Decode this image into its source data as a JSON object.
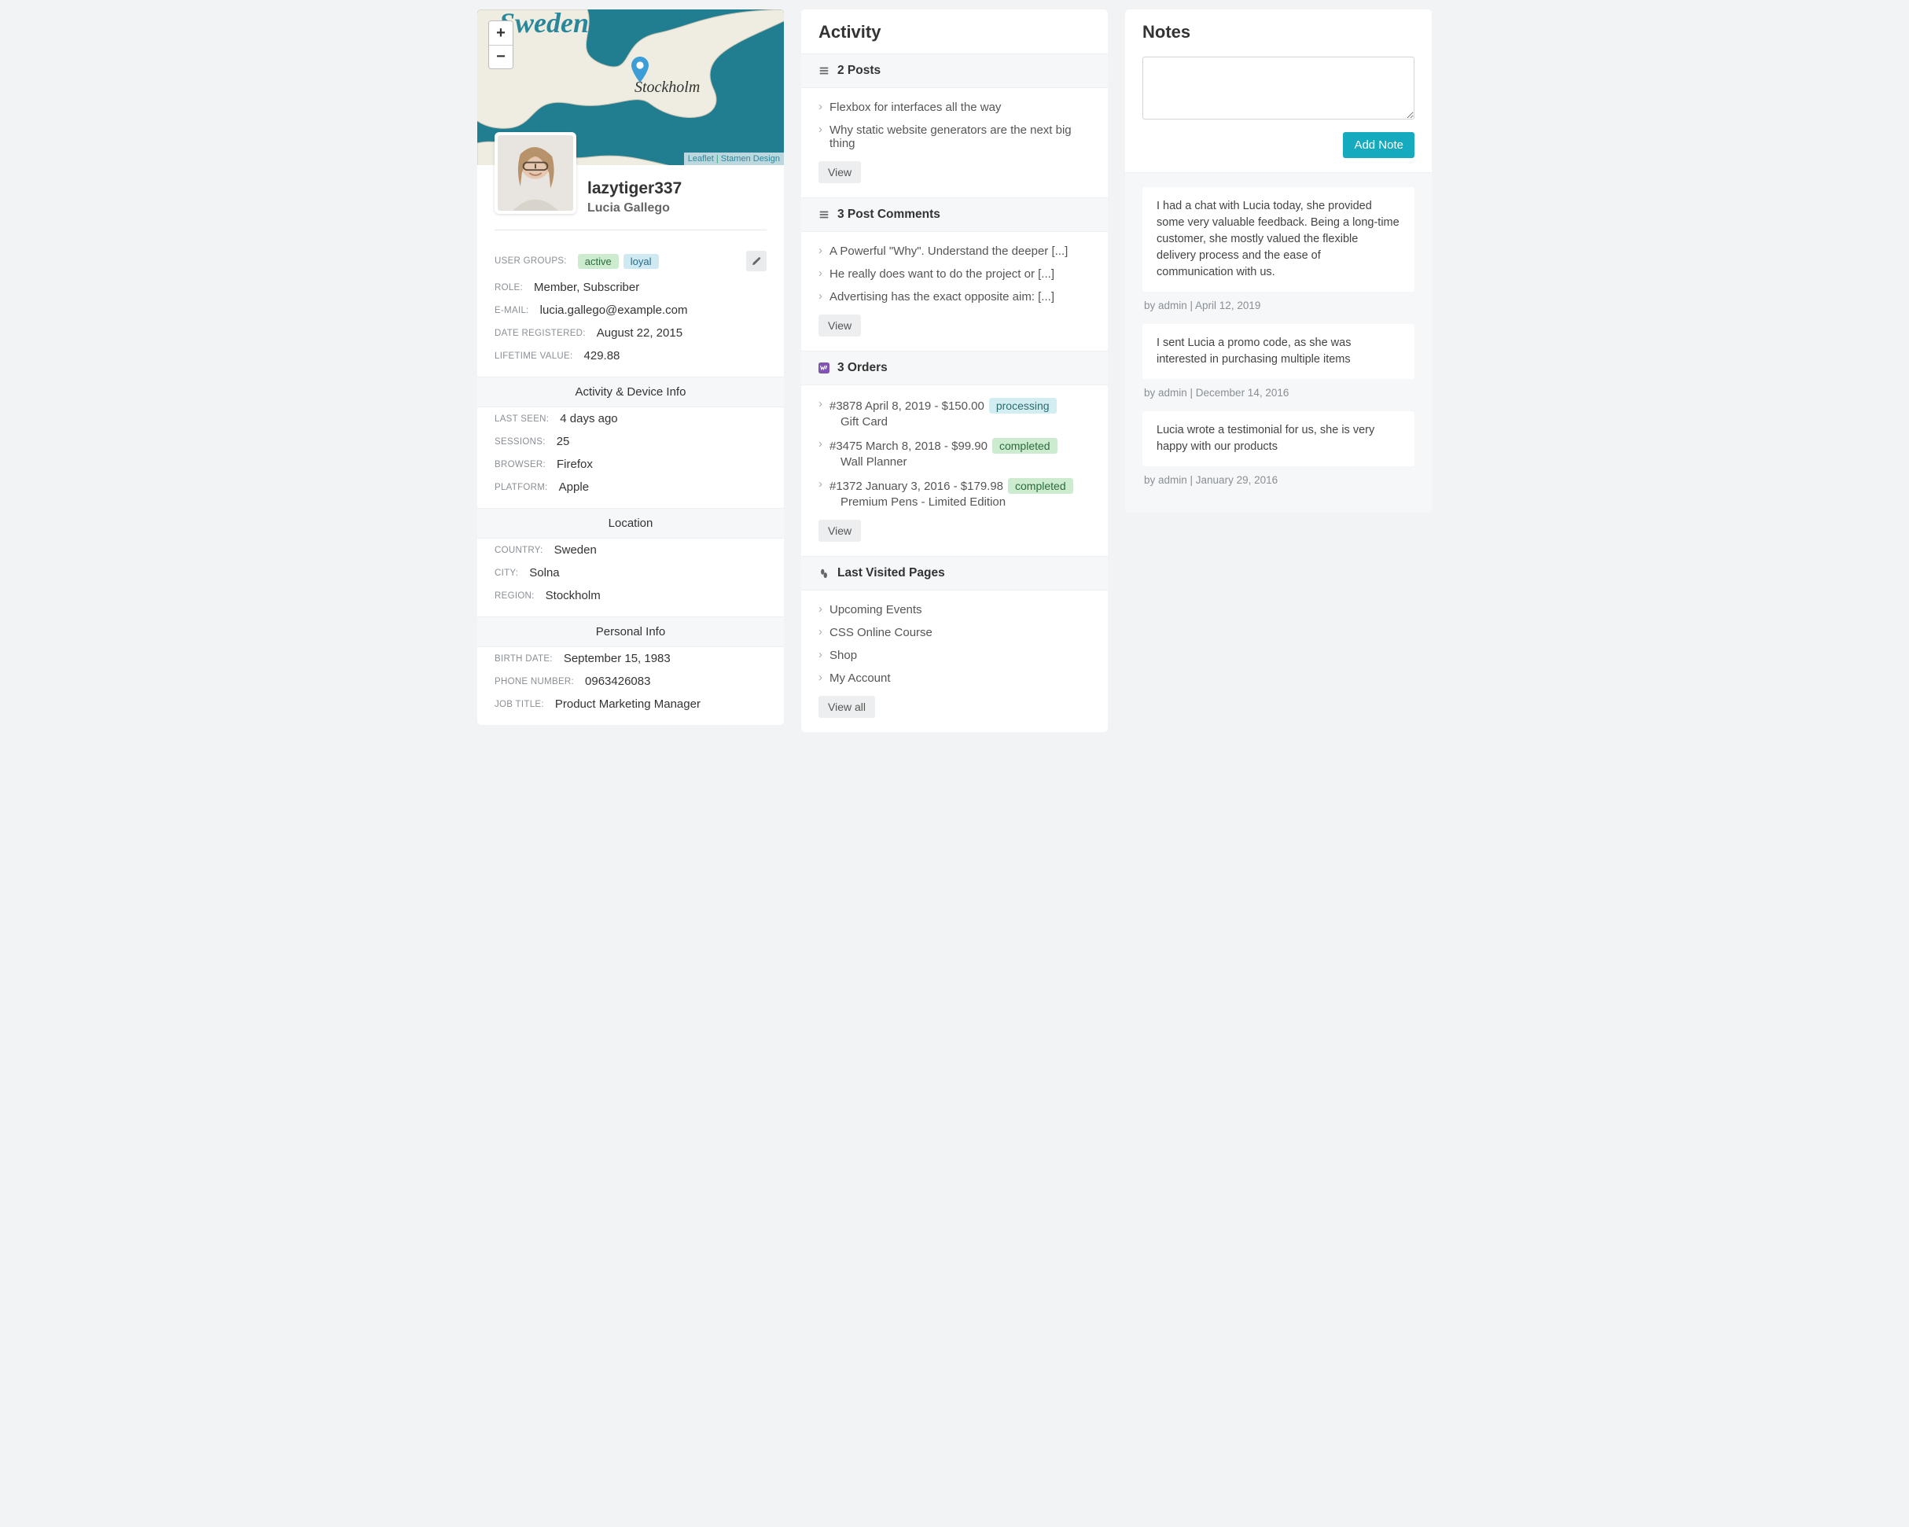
{
  "profile": {
    "map": {
      "country_label": "Sweden",
      "city_label": "Stockholm",
      "attribution_leaflet": "Leaflet",
      "attribution_tiles": "Stamen Design",
      "zoom_in": "+",
      "zoom_out": "−"
    },
    "username": "lazytiger337",
    "fullname": "Lucia Gallego",
    "groups_label": "User Groups:",
    "groups": {
      "active": "active",
      "loyal": "loyal"
    },
    "role_label": "Role:",
    "role_value": "Member, Subscriber",
    "email_label": "E-mail:",
    "email_value": "lucia.gallego@example.com",
    "registered_label": "Date Registered:",
    "registered_value": "August 22, 2015",
    "ltv_label": "Lifetime Value:",
    "ltv_value": "429.88",
    "device_header": "Activity & Device Info",
    "lastseen_label": "Last Seen:",
    "lastseen_value": "4 days ago",
    "sessions_label": "Sessions:",
    "sessions_value": "25",
    "browser_label": "Browser:",
    "browser_value": "Firefox",
    "platform_label": "Platform:",
    "platform_value": "Apple",
    "location_header": "Location",
    "country_label": "Country:",
    "country_value": "Sweden",
    "city_label": "City:",
    "city_value": "Solna",
    "region_label": "Region:",
    "region_value": "Stockholm",
    "personal_header": "Personal Info",
    "birth_label": "Birth Date:",
    "birth_value": "September 15, 1983",
    "phone_label": "Phone Number:",
    "phone_value": "0963426083",
    "job_label": "Job Title:",
    "job_value": "Product Marketing Manager"
  },
  "activity": {
    "heading": "Activity",
    "posts_header": "2 Posts",
    "posts": [
      "Flexbox for interfaces all the way",
      "Why static website generators are the next big thing"
    ],
    "comments_header": "3 Post Comments",
    "comments": [
      "A Powerful \"Why\". Understand the deeper [...]",
      "He really does want to do the project or [...]",
      "Advertising has the exact opposite aim: [...]"
    ],
    "orders_header": "3 Orders",
    "orders": [
      {
        "line": "#3878 April 8, 2019 - $150.00",
        "status": "processing",
        "status_class": "processing",
        "product": "Gift Card"
      },
      {
        "line": "#3475 March 8, 2018 - $99.90",
        "status": "completed",
        "status_class": "completed",
        "product": "Wall Planner"
      },
      {
        "line": "#1372 January 3, 2016 - $179.98",
        "status": "completed",
        "status_class": "completed",
        "product": "Premium Pens - Limited Edition"
      }
    ],
    "pages_header": "Last Visited Pages",
    "pages": [
      "Upcoming Events",
      "CSS Online Course",
      "Shop",
      "My Account"
    ],
    "view_label": "View",
    "view_all_label": "View all"
  },
  "notes": {
    "heading": "Notes",
    "add_button": "Add Note",
    "placeholder": "",
    "items": [
      {
        "text": "I had a chat with Lucia today, she provided some very valuable feedback. Being a long-time customer, she mostly valued the flexible delivery process and the ease of communication with us.",
        "meta": "by admin | April 12, 2019"
      },
      {
        "text": "I sent Lucia a promo code, as she was interested in purchasing multiple items",
        "meta": "by admin | December 14, 2016"
      },
      {
        "text": "Lucia wrote a testimonial for us, she is very happy with our products",
        "meta": "by admin | January 29, 2016"
      }
    ]
  }
}
